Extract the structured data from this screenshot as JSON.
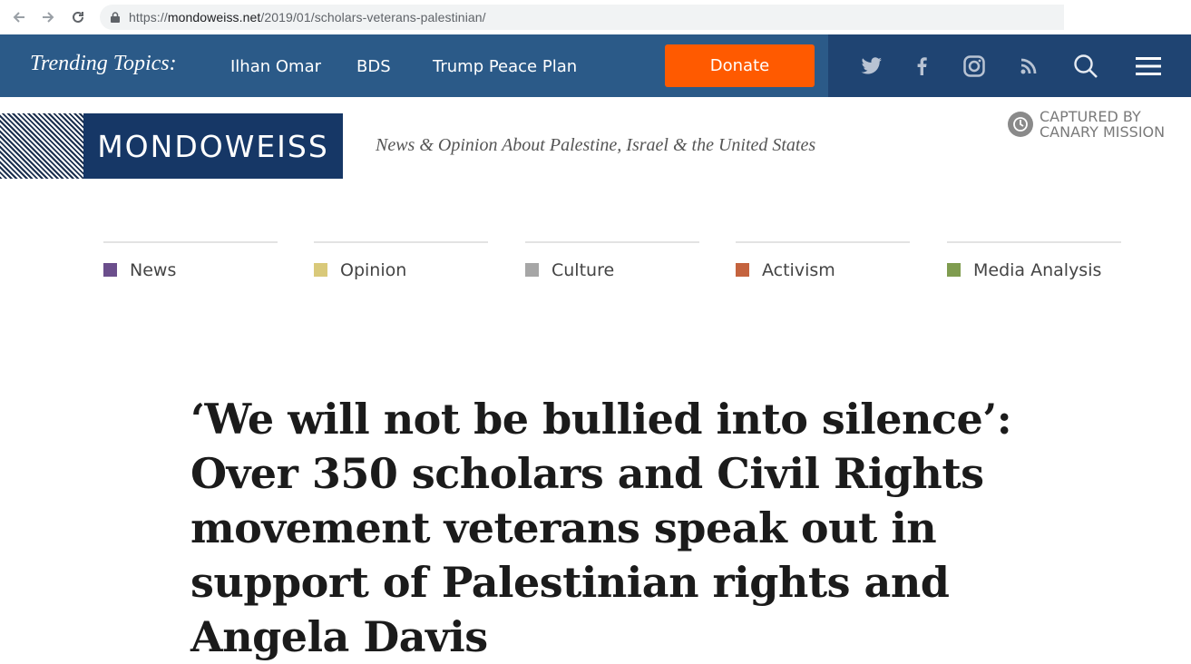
{
  "browser": {
    "url_scheme": "https://",
    "url_host": "mondoweiss.net",
    "url_path": "/2019/01/scholars-veterans-palestinian/"
  },
  "topbar": {
    "trending_label": "Trending Topics:",
    "trending_links": [
      "Ilhan Omar",
      "BDS",
      "Trump Peace Plan"
    ],
    "donate_label": "Donate",
    "icons": [
      "twitter-icon",
      "facebook-icon",
      "instagram-icon",
      "rss-icon",
      "search-icon",
      "menu-icon"
    ]
  },
  "brand": {
    "logo": "MONDOWEISS",
    "tagline": "News & Opinion About Palestine, Israel & the United States",
    "badge_line1": "CAPTURED BY",
    "badge_line2": "CANARY MISSION"
  },
  "categories": [
    {
      "label": "News",
      "color": "#6b4e8c"
    },
    {
      "label": "Opinion",
      "color": "#d9c97a"
    },
    {
      "label": "Culture",
      "color": "#a6a6a6"
    },
    {
      "label": "Activism",
      "color": "#c4633e"
    },
    {
      "label": "Media Analysis",
      "color": "#7f9c4f"
    }
  ],
  "article": {
    "headline": "‘We will not be bullied into silence’: Over 350 scholars and Civil Rights movement veterans speak out in support of Palestinian rights and Angela Davis"
  },
  "colors": {
    "topbar_bg": "#2b5a88",
    "iconbar_bg": "#1f4472",
    "donate_bg": "#ff5a00",
    "brand_bg": "#163766"
  }
}
